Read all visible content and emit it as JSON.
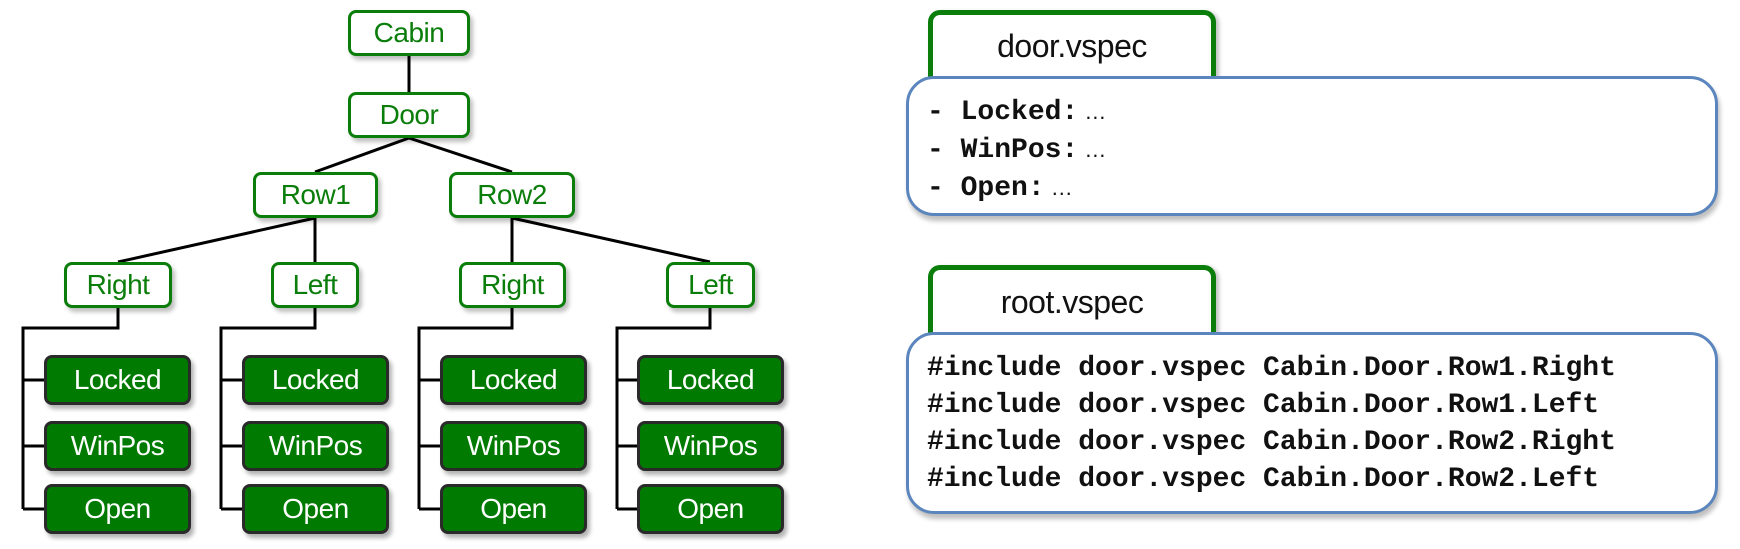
{
  "tree": {
    "root": "Cabin",
    "level1": "Door",
    "rows": [
      "Row1",
      "Row2"
    ],
    "sides": [
      {
        "label": "Right",
        "row": "Row1"
      },
      {
        "label": "Left",
        "row": "Row1"
      },
      {
        "label": "Right",
        "row": "Row2"
      },
      {
        "label": "Left",
        "row": "Row2"
      }
    ],
    "signals": [
      "Locked",
      "WinPos",
      "Open"
    ]
  },
  "door_file": {
    "title": "door.vspec",
    "lines": [
      {
        "prefix": "- ",
        "name": "Locked",
        "sep": ":",
        "rest": " …"
      },
      {
        "prefix": "- ",
        "name": "WinPos",
        "sep": ":",
        "rest": " …"
      },
      {
        "prefix": "- ",
        "name": "Open",
        "sep": ":",
        "rest": " …"
      }
    ]
  },
  "root_file": {
    "title": "root.vspec",
    "lines": [
      "#include door.vspec Cabin.Door.Row1.Right",
      "#include door.vspec Cabin.Door.Row1.Left",
      "#include door.vspec Cabin.Door.Row2.Right",
      "#include door.vspec Cabin.Door.Row2.Left"
    ]
  },
  "colors": {
    "branch_green": "#0a7d0a",
    "leaf_fill": "#007a00",
    "file_border_blue": "#5b86bd",
    "connector": "#000000"
  }
}
